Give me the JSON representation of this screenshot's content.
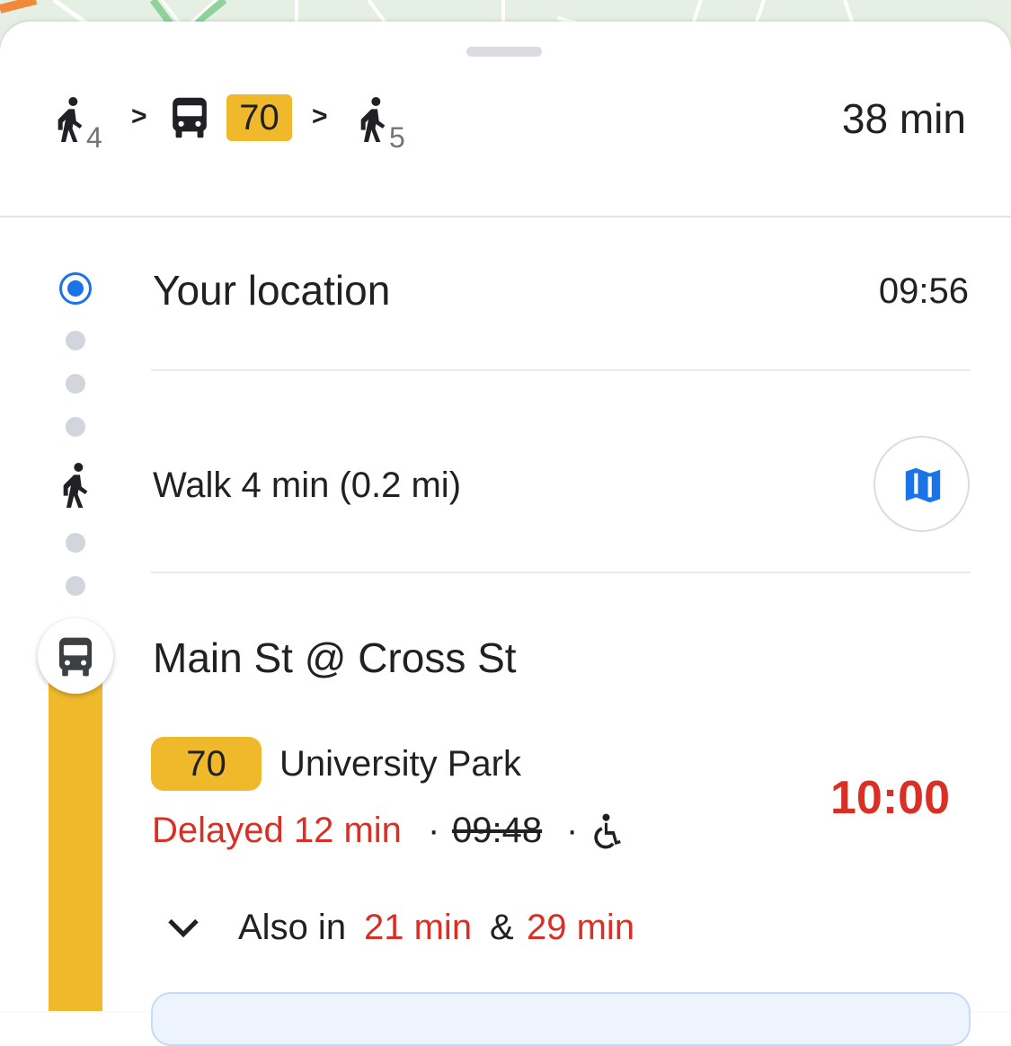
{
  "summary": {
    "walk_before_min": "4",
    "route": "70",
    "walk_after_min": "5",
    "total_time": "38 min",
    "step_separator": ">"
  },
  "steps": {
    "origin": {
      "name": "Your location",
      "time": "09:56"
    },
    "walk": {
      "label": "Walk 4 min (0.2 mi)"
    },
    "stop": {
      "name": "Main St @ Cross St"
    }
  },
  "departure": {
    "route": "70",
    "headsign": "University Park",
    "delay": "Delayed 12 min",
    "separator": "·",
    "scheduled_time": "09:48",
    "arrival_time": "10:00",
    "also_prefix": "Also in",
    "also_first": "21 min",
    "also_joiner": "&",
    "also_second": "29 min"
  },
  "icons": {
    "walk": "walk-icon",
    "bus": "bus-icon",
    "map": "map-icon",
    "wheelchair": "wheelchair-icon",
    "expand": "chevron-down-icon"
  },
  "colors": {
    "route_yellow": "#f0b92c",
    "delay_red": "#d93025",
    "origin_blue": "#1a73e8"
  }
}
